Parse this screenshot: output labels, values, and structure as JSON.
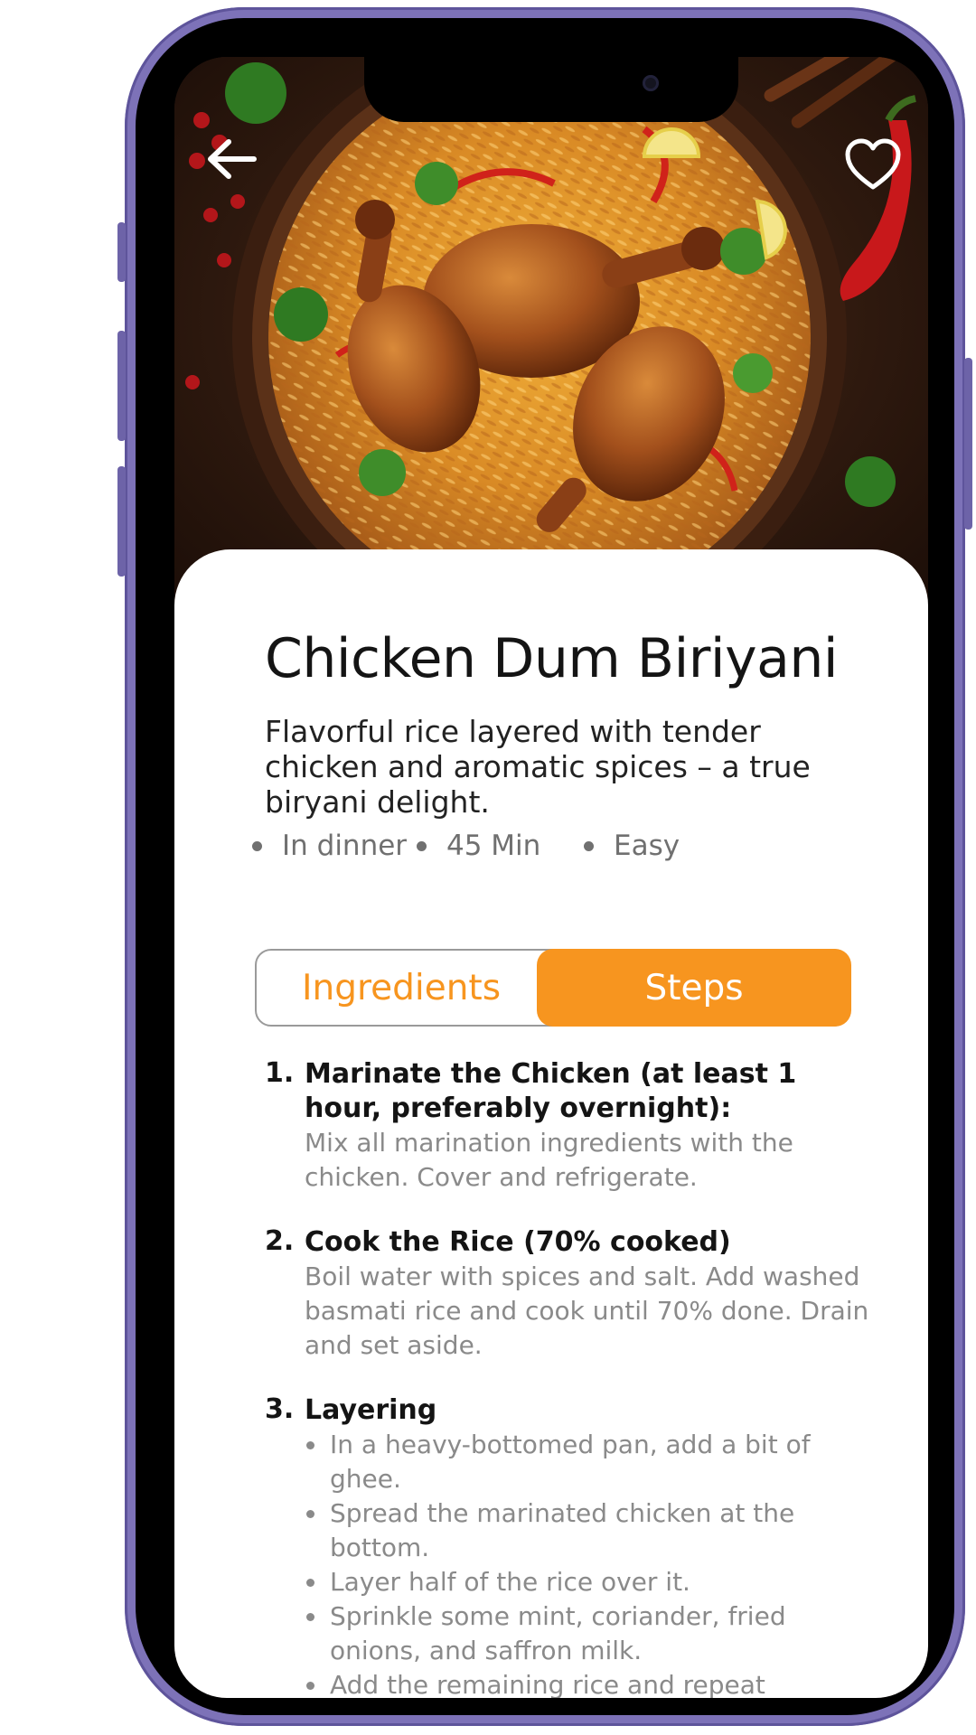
{
  "recipe": {
    "title": "Chicken Dum Biriyani",
    "description": "Flavorful rice layered with tender chicken and aromatic spices – a true biryani delight.",
    "meta": [
      {
        "label": "In dinner"
      },
      {
        "label": "45 Min"
      },
      {
        "label": "Easy"
      }
    ]
  },
  "tabs": {
    "ingredients_label": "Ingredients",
    "steps_label": "Steps",
    "active": "Steps"
  },
  "steps": [
    {
      "number": "1.",
      "title": "Marinate the Chicken (at least 1 hour, preferably overnight):",
      "body": "Mix all marination ingredients with the chicken. Cover and refrigerate."
    },
    {
      "number": "2.",
      "title": "Cook the Rice (70% cooked)",
      "body": "Boil water with spices and salt. Add washed basmati rice and cook until 70% done. Drain and set aside."
    },
    {
      "number": "3.",
      "title": "Layering",
      "items": [
        "In a heavy-bottomed pan, add a bit of ghee.",
        "Spread the marinated chicken at the bottom.",
        "Layer half of the rice over it.",
        "Sprinkle some mint, coriander, fried onions, and saffron milk.",
        "Add the remaining rice and repeat toppings."
      ]
    }
  ],
  "icons": {
    "back": "arrow-left-icon",
    "favorite": "heart-outline-icon"
  },
  "colors": {
    "accent": "#f7951f",
    "phone_frame": "#7d72b8"
  }
}
